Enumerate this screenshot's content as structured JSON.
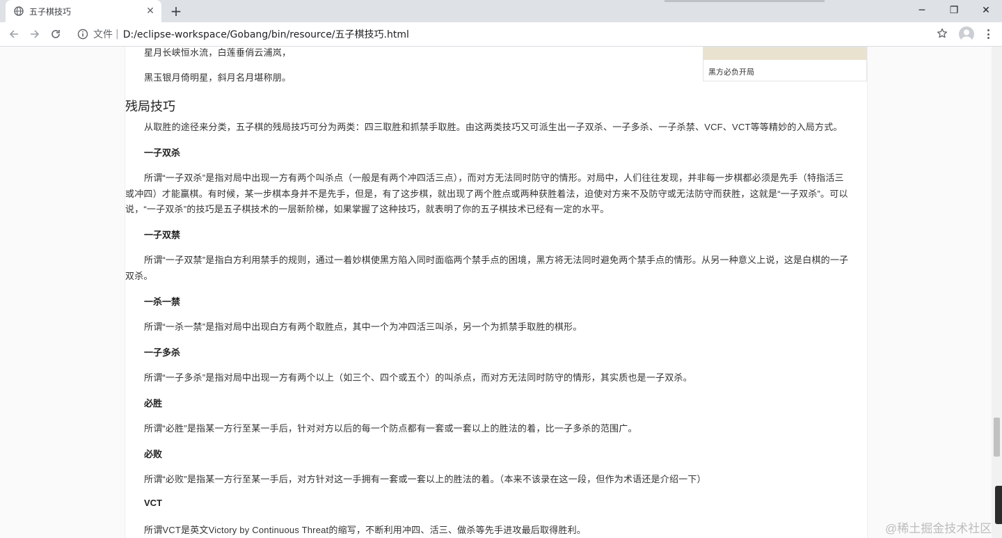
{
  "browser": {
    "tab_title": "五子棋技巧",
    "new_tab": "+",
    "scheme_label": "文件",
    "separator": "|",
    "url": "D:/eclipse-workspace/Gobang/bin/resource/五子棋技巧.html",
    "win_min": "─",
    "win_restore": "❐",
    "win_close": "✕"
  },
  "page": {
    "poem_line_1": "星月长峡恒水流，白莲垂俏云浦岚，",
    "poem_line_2": "黑玉银月倚明星，斜月名月堪称朋。",
    "figure_caption": "黑方必负开局",
    "section_title": "残局技巧",
    "intro": "从取胜的途径来分类，五子棋的残局技巧可分为两类：四三取胜和抓禁手取胜。由这两类技巧又可派生出一子双杀、一子多杀、一子杀禁、VCF、VCT等等精妙的入局方式。",
    "h_shuangsha": "一子双杀",
    "p_shuangsha_1": "所谓“一子双杀”是指对局中出现一方有两个叫杀点（一般是有两个冲四活三点），而对方无法同时防守的情形。对局中，人们往往发现，并非每一步棋都必须是先手（特指活三",
    "p_shuangsha_2": "或冲四）才能赢棋。有时候，某一步棋本身并不是先手，但是，有了这步棋，就出现了两个胜点或两种获胜着法，迫使对方来不及防守或无法防守而获胜，这就是“一子双杀”。可以",
    "p_shuangsha_3": "说，“一子双杀”的技巧是五子棋技术的一层新阶梯，如果掌握了这种技巧，就表明了你的五子棋技术已经有一定的水平。",
    "h_shuangjin": "一子双禁",
    "p_shuangjin_1": "所谓“一子双禁”是指白方利用禁手的规则，通过一着妙棋使黑方陷入同时面临两个禁手点的困境，黑方将无法同时避免两个禁手点的情形。从另一种意义上说，这是白棋的一子",
    "p_shuangjin_2": "双杀。",
    "h_shajin": "一杀一禁",
    "p_shajin": "所谓“一杀一禁”是指对局中出现白方有两个取胜点，其中一个为冲四活三叫杀，另一个为抓禁手取胜的棋形。",
    "h_duosha": "一子多杀",
    "p_duosha": "所谓“一子多杀”是指对局中出现一方有两个以上（如三个、四个或五个）的叫杀点，而对方无法同时防守的情形，其实质也是一子双杀。",
    "h_bisheng": "必胜",
    "p_bisheng": "所谓“必胜”是指某一方行至某一手后，针对对方以后的每一个防点都有一套或一套以上的胜法的着，比一子多杀的范围广。",
    "h_bibai": "必败",
    "p_bibai": "所谓“必败”是指某一方行至某一手后，对方针对这一手拥有一套或一套以上的胜法的着。（本来不该录在这一段，但作为术语还是介绍一下）",
    "h_vct": "VCT",
    "p_vct": "所谓VCT是英文Victory by Continuous Threat的缩写，不断利用冲四、活三、做杀等先手进攻最后取得胜利。"
  },
  "watermark": "@稀土掘金技术社区"
}
